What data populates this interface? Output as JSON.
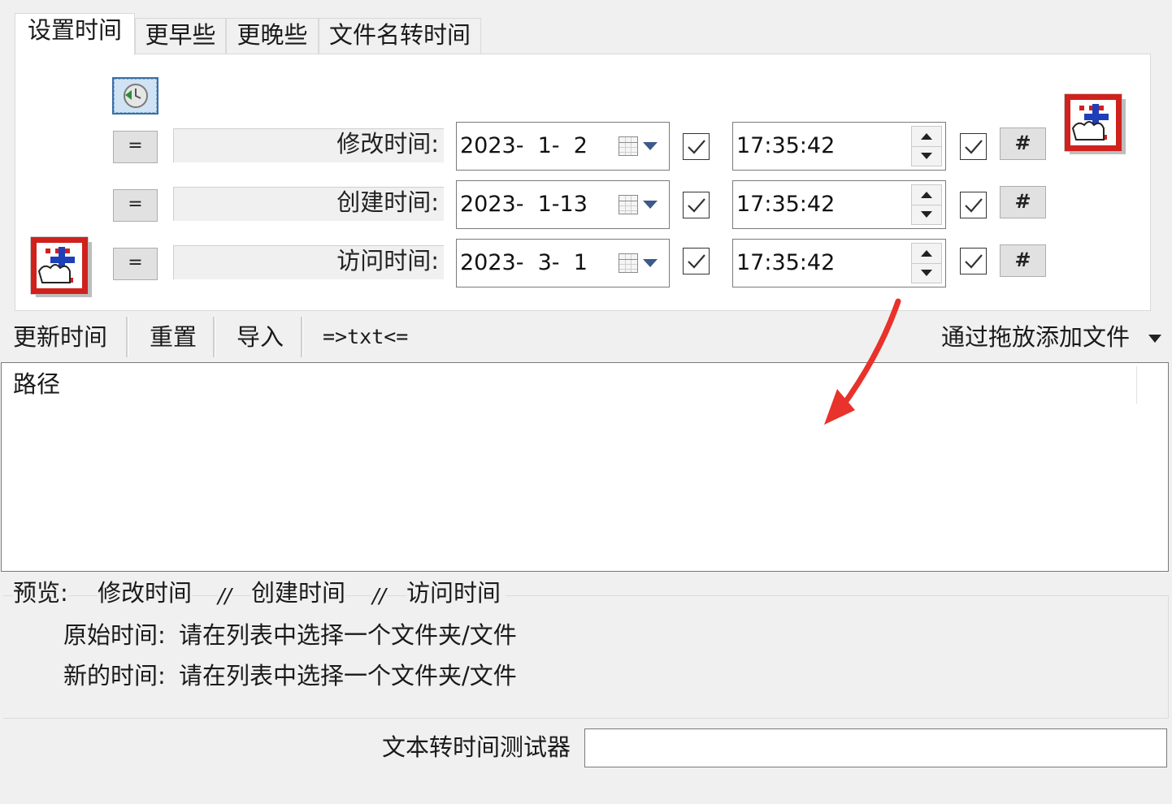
{
  "tabs": [
    {
      "label": "设置时间",
      "active": true
    },
    {
      "label": "更早些",
      "active": false
    },
    {
      "label": "更晚些",
      "active": false
    },
    {
      "label": "文件名转时间",
      "active": false
    }
  ],
  "time_rows": [
    {
      "equals": "=",
      "label": "修改时间:",
      "date": "2023-  1-  2",
      "date_checked": true,
      "time": "17:35:42",
      "time_checked": true,
      "hash": "#"
    },
    {
      "equals": "=",
      "label": "创建时间:",
      "date": "2023-  1-13",
      "date_checked": true,
      "time": "17:35:42",
      "time_checked": true,
      "hash": "#"
    },
    {
      "equals": "=",
      "label": "访问时间:",
      "date": "2023-  3-  1",
      "date_checked": true,
      "time": "17:35:42",
      "time_checked": true,
      "hash": "#"
    }
  ],
  "toolbar": {
    "update": "更新时间",
    "reset": "重置",
    "import": "导入",
    "txt": "=>txt<=",
    "drag_add": "通过拖放添加文件"
  },
  "list": {
    "column_header": "路径"
  },
  "preview": {
    "label": "预览:",
    "modified": "修改时间",
    "sep1": "//",
    "created": "创建时间",
    "sep2": "//",
    "accessed": "访问时间",
    "original_label": "原始时间:",
    "original_value": "请在列表中选择一个文件夹/文件",
    "new_label": "新的时间:",
    "new_value": "请在列表中选择一个文件夹/文件"
  },
  "tester": {
    "label": "文本转时间测试器",
    "value": ""
  },
  "colors": {
    "annotation_arrow": "#e8322b",
    "check": "#333333",
    "dropdown_arrow": "#3c5a8a"
  }
}
